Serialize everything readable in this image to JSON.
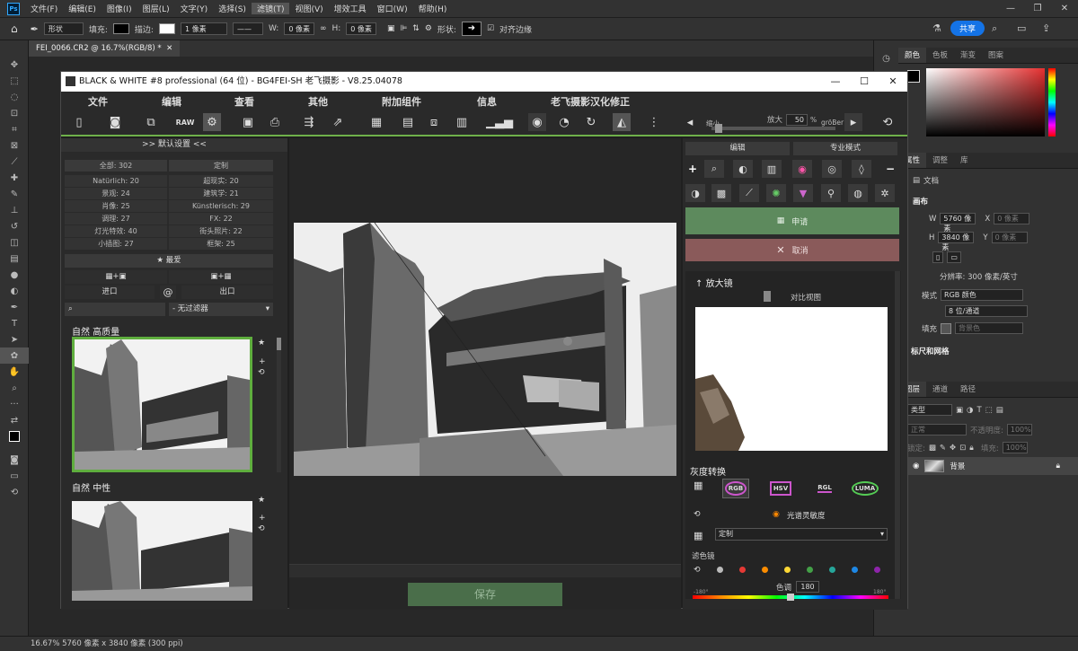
{
  "app": {
    "menu": [
      "文件(F)",
      "编辑(E)",
      "图像(I)",
      "图层(L)",
      "文字(Y)",
      "选择(S)",
      "滤镜(T)",
      "视图(V)",
      "增效工具",
      "窗口(W)",
      "帮助(H)"
    ],
    "active_menu": "滤镜(T)",
    "share_label": "共享"
  },
  "options": {
    "shape_mode": "形状",
    "fill_label": "填充:",
    "stroke_label": "描边:",
    "stroke_width": "1 像素",
    "w_label": "W:",
    "w_value": "0 像素",
    "h_label": "H:",
    "h_value": "0 像素",
    "shape_label": "形状:",
    "align_edges": "对齐边缘"
  },
  "document": {
    "tab": "FEI_0066.CR2 @ 16.7%(RGB/8) *",
    "status": "16.67%  5760 像素 x 3840 像素 (300 ppi)"
  },
  "plugin": {
    "title": "BLACK & WHITE #8 professional (64 位) - BG4FEI-SH 老飞摄影 - V8.25.04078",
    "menus": [
      "文件",
      "编辑",
      "查看",
      "其他",
      "附加组件",
      "信息",
      "老飞摄影汉化修正"
    ],
    "zoom_label": "放大",
    "zoom_value": "50",
    "zoom_unit": "%",
    "small_label": "缩小",
    "bigger_label": "gröBer",
    "left": {
      "header": ">> 默认设置 <<",
      "all": "全部: 302",
      "custom": "定制",
      "categories": [
        [
          "Natürlich: 20",
          "超现实: 20"
        ],
        [
          "景观: 24",
          "建筑学: 21"
        ],
        [
          "肖像: 25",
          "Künstlerisch: 29"
        ],
        [
          "调理: 27",
          "FX: 22"
        ],
        [
          "灯光特效: 40",
          "街头照片: 22"
        ],
        [
          "小插图: 27",
          "框架: 25"
        ]
      ],
      "favorites": "★ 最爱",
      "import": "进口",
      "export": "出口",
      "filter": "- 无过滤器",
      "preset1": "自然 高质量",
      "preset2": "自然 中性"
    },
    "center": {
      "save": "保存"
    },
    "right": {
      "tab_edit": "编辑",
      "tab_pro": "专业模式",
      "apply": "申请",
      "cancel": "取消",
      "magnifier": "放大镜",
      "compare": "对比视图",
      "gray_title": "灰度转换",
      "gray_modes": [
        "RGB",
        "HSV",
        "RGL",
        "LUMA"
      ],
      "spectral": "光谱灵敏度",
      "custom": "定制",
      "filter_label": "滤色镜",
      "hue_label": "色调",
      "hue_value": "180",
      "hue_min": "-180°",
      "hue_max": "180°",
      "dot_colors": [
        "#bbbbbb",
        "#e53935",
        "#fb8c00",
        "#fdd835",
        "#43a047",
        "#26a69a",
        "#1e88e5",
        "#8e24aa"
      ]
    }
  },
  "panels": {
    "top_tabs": [
      "颜色",
      "色板",
      "渐变",
      "图案"
    ],
    "mid_tabs": [
      "属性",
      "调整",
      "库"
    ],
    "doc_label": "文档",
    "canvas_label": "画布",
    "w_label": "W",
    "w_value": "5760 像素",
    "x_label": "X",
    "x_value": "0 像素",
    "h_label": "H",
    "h_value": "3840 像素",
    "y_label": "Y",
    "y_value": "0 像素",
    "resolution": "分辨率: 300 像素/英寸",
    "mode_label": "模式",
    "mode_value": "RGB 颜色",
    "depth_value": "8 位/通道",
    "fill_label": "填充",
    "fill_value": "背景色",
    "rulers": "标尺和网格",
    "layer_tabs": [
      "图层",
      "通道",
      "路径"
    ],
    "kind": "类型",
    "blend": "正常",
    "opacity_label": "不透明度:",
    "opacity_value": "100%",
    "lock_label": "锁定:",
    "fill2_label": "填充:",
    "fill2_value": "100%",
    "layer_name": "背景"
  }
}
